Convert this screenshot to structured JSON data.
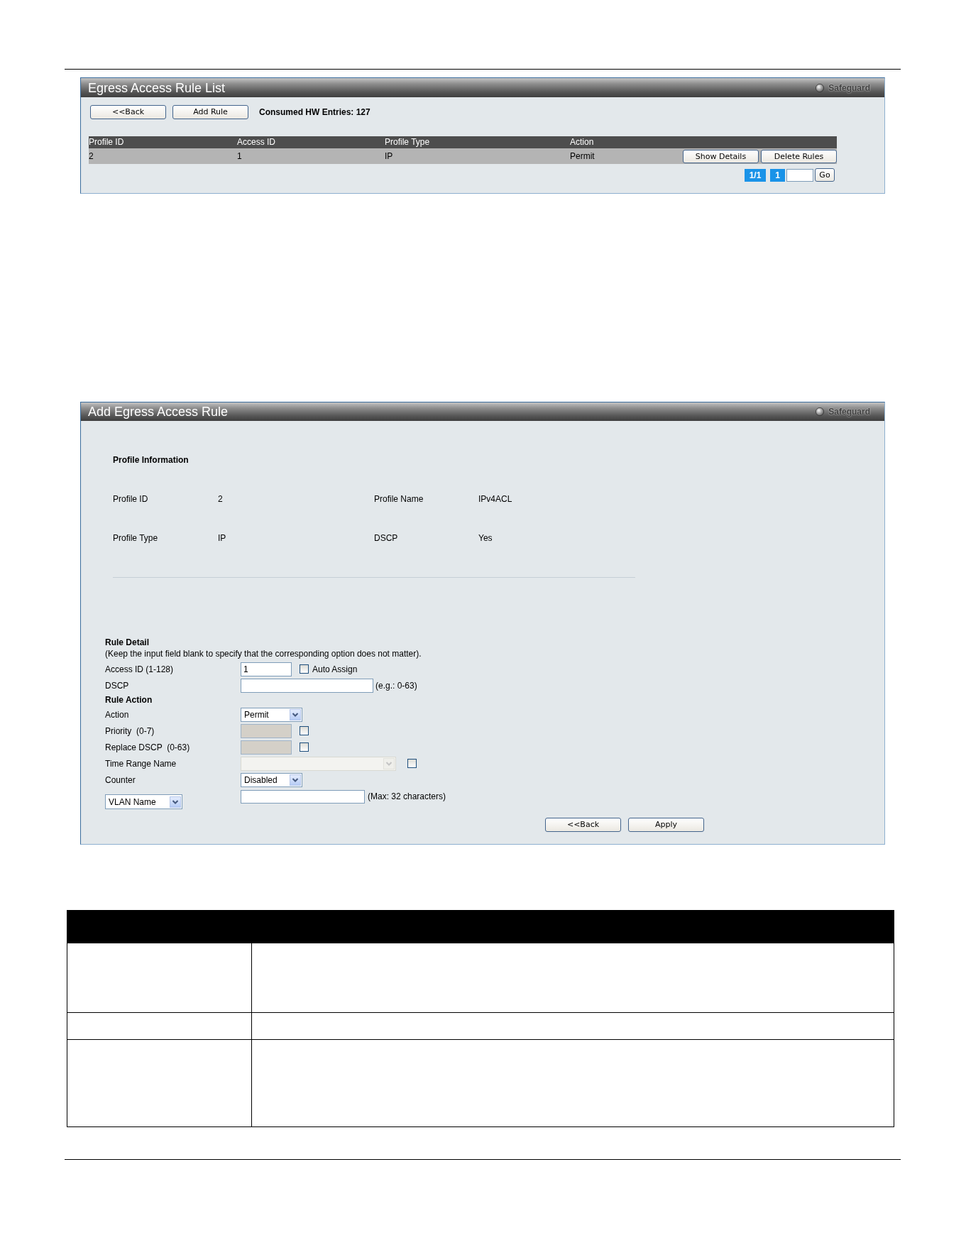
{
  "egress_rule_list": {
    "title": "Egress Access Rule List",
    "indicator": "Safeguard",
    "buttons": [
      "<<Back",
      "Add Rule"
    ],
    "consumed_entries": "Consumed HW Entries: 127",
    "table": {
      "columns": [
        "Profile ID",
        "Access ID",
        "Profile Type",
        "Action"
      ],
      "rows": [
        {
          "cells": [
            "2",
            "1",
            "IP",
            "Permit"
          ],
          "buttons": [
            "Show Details",
            "Delete Rules"
          ]
        }
      ]
    },
    "pagination": {
      "page_count": "1/1",
      "pages": [
        "1"
      ],
      "go_button": "Go"
    }
  },
  "add_egress_rule": {
    "title": "Add Egress Access Rule",
    "indicator": "Safeguard",
    "profile_information": {
      "heading": "Profile Information",
      "items": [
        {
          "label": "Profile ID",
          "value": "2"
        },
        {
          "label": "Profile Name",
          "value": "IPv4ACL"
        },
        {
          "label": "Profile Type",
          "value": "IP"
        },
        {
          "label": "DSCP",
          "value": "Yes"
        }
      ]
    },
    "rule_detail": {
      "heading": "Rule Detail",
      "note": "(Keep the input field blank to specify that the corresponding option does not matter).",
      "fields": [
        {
          "kind": "input",
          "label": "Access ID (1-128)",
          "value": "1",
          "disabled": false,
          "checkbox": {
            "label": "Auto Assign",
            "checked": false
          }
        },
        {
          "kind": "input",
          "label": "DSCP",
          "disabled": false,
          "hint": "(e.g.: 0-63)"
        }
      ]
    },
    "rule_action": {
      "heading": "Rule Action",
      "fields": [
        {
          "kind": "select",
          "label": "Action",
          "value": "Permit",
          "disabled": false
        },
        {
          "kind": "input",
          "label": "Priority  (0-7)",
          "disabled": true,
          "checkbox": {
            "checked": false
          }
        },
        {
          "kind": "input",
          "label": "Replace DSCP  (0-63)",
          "disabled": true,
          "checkbox": {
            "checked": false
          }
        },
        {
          "kind": "select",
          "label": "Time Range Name",
          "disabled": true,
          "checkbox": {
            "checked": false
          }
        },
        {
          "kind": "select",
          "label": "Counter",
          "value": "Disabled",
          "disabled": false
        },
        {
          "kind": "select-input",
          "selector": "VLAN Name",
          "disabled": false,
          "hint": "(Max: 32 characters)"
        }
      ]
    },
    "buttons": [
      "<<Back",
      "Apply"
    ]
  }
}
